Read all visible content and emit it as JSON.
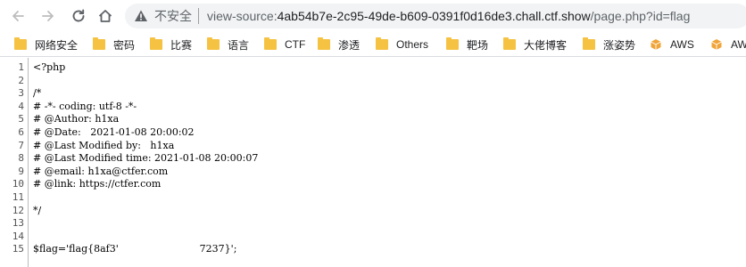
{
  "browser": {
    "address_bar": {
      "security_label": "不安全",
      "url_scheme": "view-source:",
      "url_host": "4ab54b7e-2c95-49de-b609-0391f0d16de3.chall.ctf.show",
      "url_path": "/page.php?id=flag"
    },
    "bookmarks": [
      {
        "label": "网络安全",
        "icon": "folder-icon"
      },
      {
        "label": "密码",
        "icon": "folder-icon"
      },
      {
        "label": "比赛",
        "icon": "folder-icon"
      },
      {
        "label": "语言",
        "icon": "folder-icon"
      },
      {
        "label": "CTF",
        "icon": "folder-icon"
      },
      {
        "label": "渗透",
        "icon": "folder-icon"
      },
      {
        "label": "Others",
        "icon": "folder-icon"
      },
      {
        "label": "靶场",
        "icon": "folder-icon"
      },
      {
        "label": "大佬博客",
        "icon": "folder-icon"
      },
      {
        "label": "涨姿势",
        "icon": "folder-icon"
      },
      {
        "label": "AWS",
        "icon": "aws-cube-icon"
      },
      {
        "label": "AW",
        "icon": "aws-cube-icon"
      }
    ],
    "colors": {
      "bookmark_folder": "#f5c242",
      "aws_cube": "#f0a43a",
      "omnibox_bg": "#f1f3f4"
    }
  },
  "source_view": {
    "lines": [
      {
        "n": "1",
        "text": "<?php"
      },
      {
        "n": "2",
        "text": ""
      },
      {
        "n": "3",
        "text": "/*"
      },
      {
        "n": "4",
        "text": "# -*- coding: utf-8 -*-"
      },
      {
        "n": "5",
        "text": "# @Author: h1xa"
      },
      {
        "n": "6",
        "text": "# @Date:   2021-01-08 20:00:02"
      },
      {
        "n": "7",
        "text": "# @Last Modified by:   h1xa"
      },
      {
        "n": "8",
        "text": "# @Last Modified time: 2021-01-08 20:00:07"
      },
      {
        "n": "9",
        "text": "# @email: h1xa@ctfer.com"
      },
      {
        "n": "10",
        "text": "# @link: https://ctfer.com"
      },
      {
        "n": "11",
        "text": ""
      },
      {
        "n": "12",
        "text": "*/"
      },
      {
        "n": "13",
        "text": ""
      },
      {
        "n": "14",
        "text": ""
      },
      {
        "n": "15",
        "text": "$flag='flag{8af3'                          7237}';"
      }
    ]
  }
}
